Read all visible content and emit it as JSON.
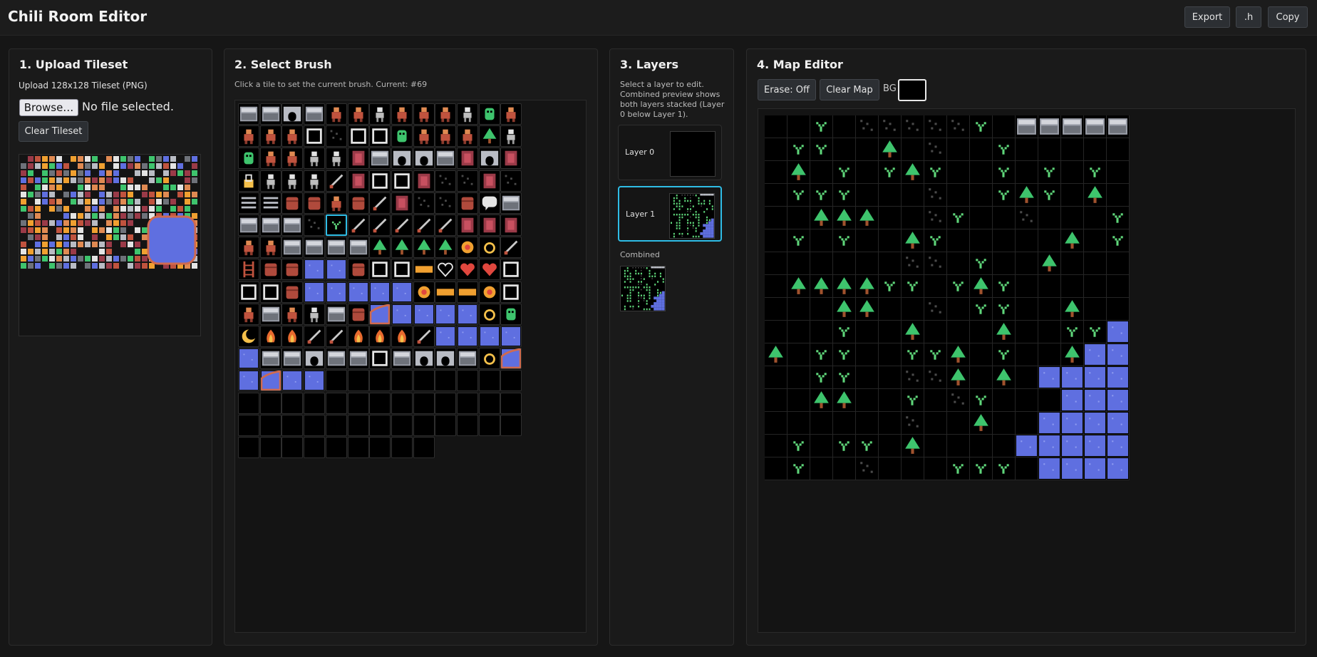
{
  "app": {
    "title": "Chili Room Editor"
  },
  "toolbar": {
    "export_label": "Export",
    "h_label": ".h",
    "copy_label": "Copy"
  },
  "upload": {
    "title": "1. Upload Tileset",
    "description": "Upload 128x128 Tileset (PNG)",
    "browse_label": "Browse…",
    "file_status": "No file selected.",
    "clear_label": "Clear Tileset"
  },
  "brush": {
    "title": "2. Select Brush",
    "hint": "Click a tile to set the current brush. Current: #69",
    "current_index": 69,
    "tile_count": 182
  },
  "layers": {
    "title": "3. Layers",
    "description": "Select a layer to edit. Combined preview shows both layers stacked (Layer 0 below Layer 1).",
    "items": [
      {
        "label": "Layer 0",
        "active": false
      },
      {
        "label": "Layer 1",
        "active": true
      }
    ],
    "combined_label": "Combined"
  },
  "map_editor": {
    "title": "4. Map Editor",
    "erase_label": "Erase: Off",
    "clear_label": "Clear Map",
    "bg_label": "BG",
    "bg_color": "#000000",
    "grid_size": 16
  },
  "colors": {
    "accent": "#2fbde6",
    "water": "#5f6fe0",
    "tree": "#3ec46d",
    "sprout": "#5fd67a",
    "shore": "#d06a4e",
    "stone": "#b9bcc4"
  }
}
